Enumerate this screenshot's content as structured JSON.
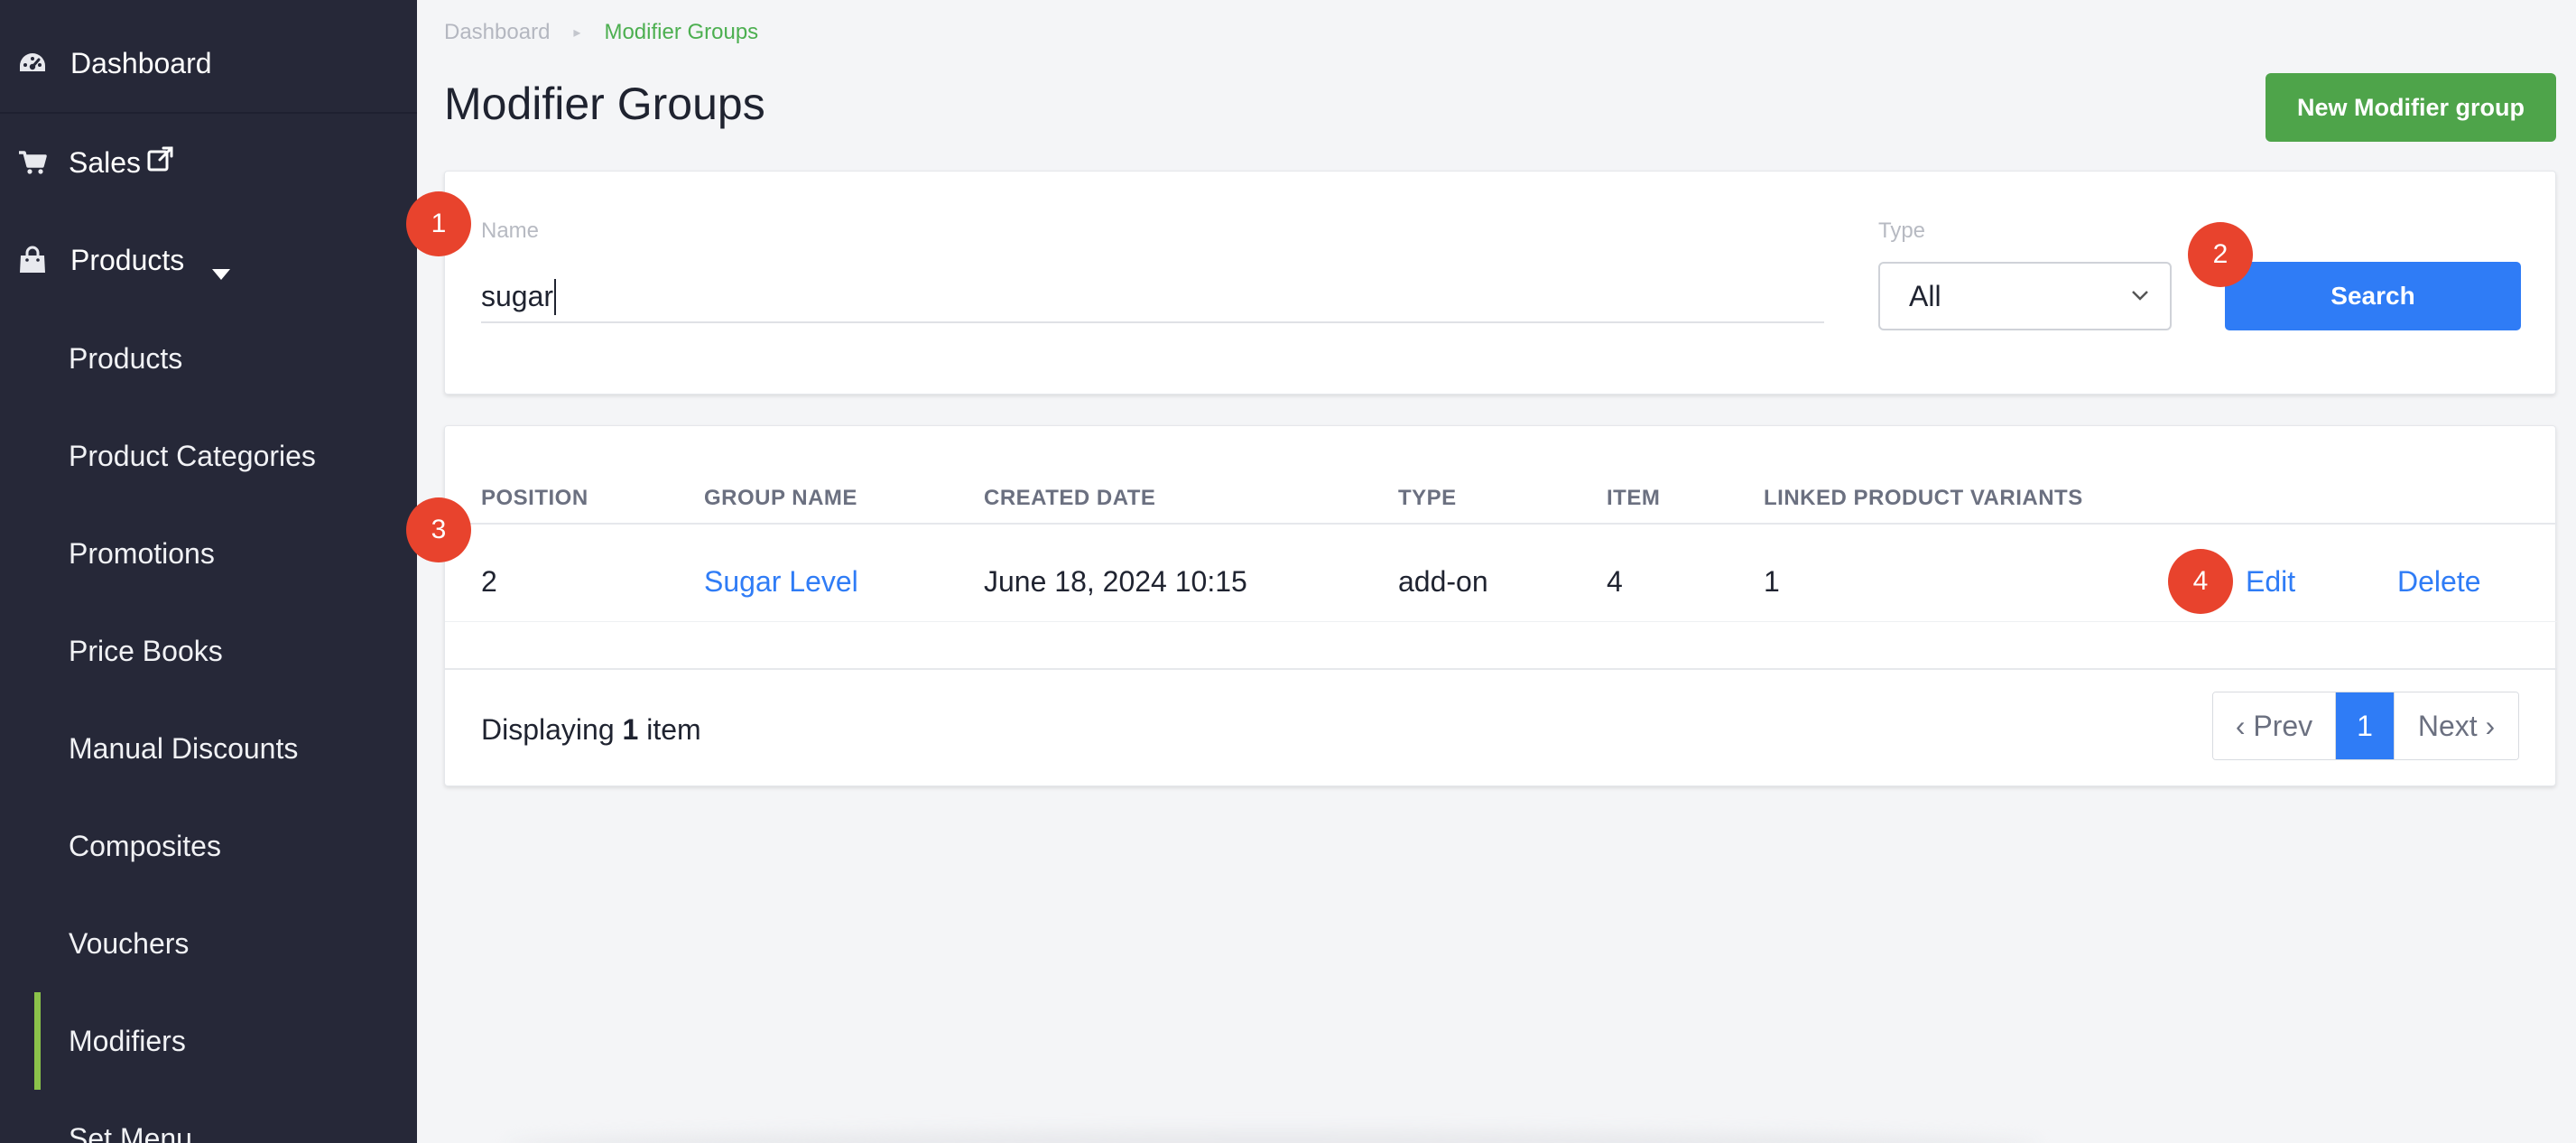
{
  "sidebar": {
    "dashboard": "Dashboard",
    "sales": "Sales",
    "products_group": "Products",
    "items": [
      "Products",
      "Product Categories",
      "Promotions",
      "Price Books",
      "Manual Discounts",
      "Composites",
      "Vouchers",
      "Modifiers",
      "Set Menu"
    ],
    "active_item": "Modifiers"
  },
  "breadcrumb": {
    "home": "Dashboard",
    "current": "Modifier Groups"
  },
  "page_title": "Modifier Groups",
  "new_button": "New Modifier group",
  "filter": {
    "name_label": "Name",
    "name_value": "sugar",
    "type_label": "Type",
    "type_value": "All",
    "search_button": "Search"
  },
  "table": {
    "headers": [
      "POSITION",
      "GROUP NAME",
      "CREATED DATE",
      "TYPE",
      "ITEM",
      "LINKED PRODUCT VARIANTS"
    ],
    "rows": [
      {
        "position": "2",
        "group_name": "Sugar Level",
        "created_date": "June 18, 2024 10:15",
        "type": "add-on",
        "item": "4",
        "linked": "1",
        "edit": "Edit",
        "delete": "Delete"
      }
    ]
  },
  "footer": {
    "displaying_prefix": "Displaying",
    "count": "1",
    "displaying_suffix": "item",
    "prev": "‹ Prev",
    "page": "1",
    "next": "Next ›"
  },
  "markers": [
    "1",
    "2",
    "3",
    "4"
  ],
  "colors": {
    "sidebar_bg": "#262838",
    "active_bar": "#8bc34a",
    "primary": "#2f7cf6",
    "success": "#4ea44a",
    "marker": "#e8432d"
  }
}
